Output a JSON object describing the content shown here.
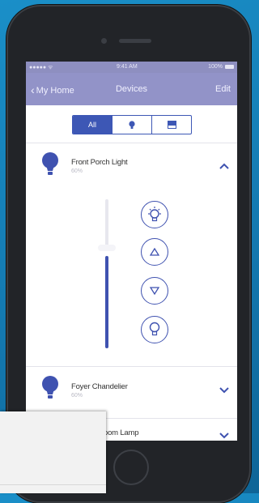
{
  "statusbar": {
    "carrier": "●●●●● ᯤ",
    "time": "9:41 AM",
    "battery": "100%"
  },
  "navbar": {
    "back_label": "My Home",
    "title": "Devices",
    "edit_label": "Edit"
  },
  "filter": {
    "all_label": "All",
    "light_icon": "bulb-icon",
    "shade_icon": "blind-icon",
    "selected": "All"
  },
  "devices": [
    {
      "name": "Front Porch Light",
      "status": "60%",
      "expanded": true,
      "level_percent": 60
    },
    {
      "name": "Foyer Chandelier",
      "status": "60%",
      "expanded": false
    },
    {
      "name": "oom Lamp",
      "expanded": false
    }
  ],
  "controls": {
    "on_icon": "bulb-on-icon",
    "up_icon": "triangle-up-icon",
    "down_icon": "triangle-down-icon",
    "off_icon": "bulb-off-icon"
  },
  "colors": {
    "accent": "#3f52b0",
    "navbar": "#9293c8",
    "background": "#1a8fc8"
  }
}
